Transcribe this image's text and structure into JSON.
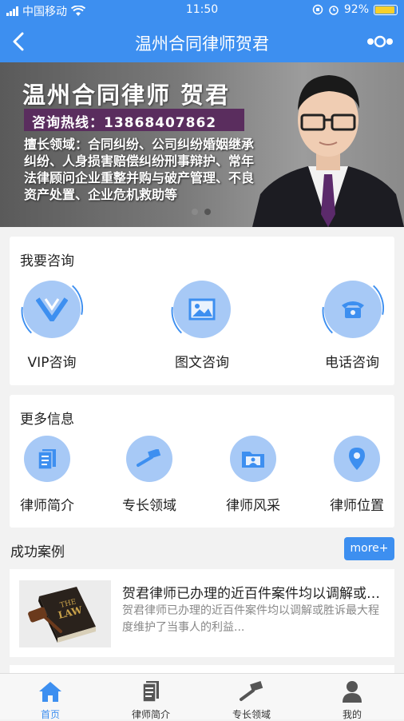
{
  "status": {
    "carrier": "中国移动",
    "time": "11:50",
    "battery": "92%"
  },
  "nav": {
    "title": "温州合同律师贺君"
  },
  "banner": {
    "title": "温州合同律师  贺君",
    "hotline": "咨询热线：13868407862",
    "desc": "擅长领域：合同纠纷、公司纠纷婚姻继承纠纷、人身损害赔偿纠纷刑事辩护、常年法律顾问企业重整并购与破产管理、不良资产处置、企业危机救助等"
  },
  "consult": {
    "title": "我要咨询",
    "items": [
      {
        "label": "VIP咨询",
        "icon": "vip-icon"
      },
      {
        "label": "图文咨询",
        "icon": "image-icon"
      },
      {
        "label": "电话咨询",
        "icon": "phone-icon"
      }
    ]
  },
  "more_info": {
    "title": "更多信息",
    "items": [
      {
        "label": "律师简介",
        "icon": "document-icon"
      },
      {
        "label": "专长领域",
        "icon": "gavel-icon"
      },
      {
        "label": "律师风采",
        "icon": "folder-icon"
      },
      {
        "label": "律师位置",
        "icon": "location-icon"
      }
    ]
  },
  "cases": {
    "title": "成功案例",
    "more_label": "more+",
    "items": [
      {
        "title": "贺君律师已办理的近百件案件均以调解或胜诉最大程度维护了当事人的利益",
        "summary": "贺君律师已办理的近百件案件均以调解或胜诉最大程度维护了当事人的利益..."
      }
    ]
  },
  "tabs": [
    {
      "label": "首页",
      "icon": "home-icon",
      "active": true
    },
    {
      "label": "律师简介",
      "icon": "document-icon",
      "active": false
    },
    {
      "label": "专长领域",
      "icon": "gavel-icon",
      "active": false
    },
    {
      "label": "我的",
      "icon": "user-icon",
      "active": false
    }
  ],
  "colors": {
    "primary": "#3d8ff0",
    "icon_bg": "#a7c9f6",
    "hotline_bg": "#5a2d5e"
  }
}
